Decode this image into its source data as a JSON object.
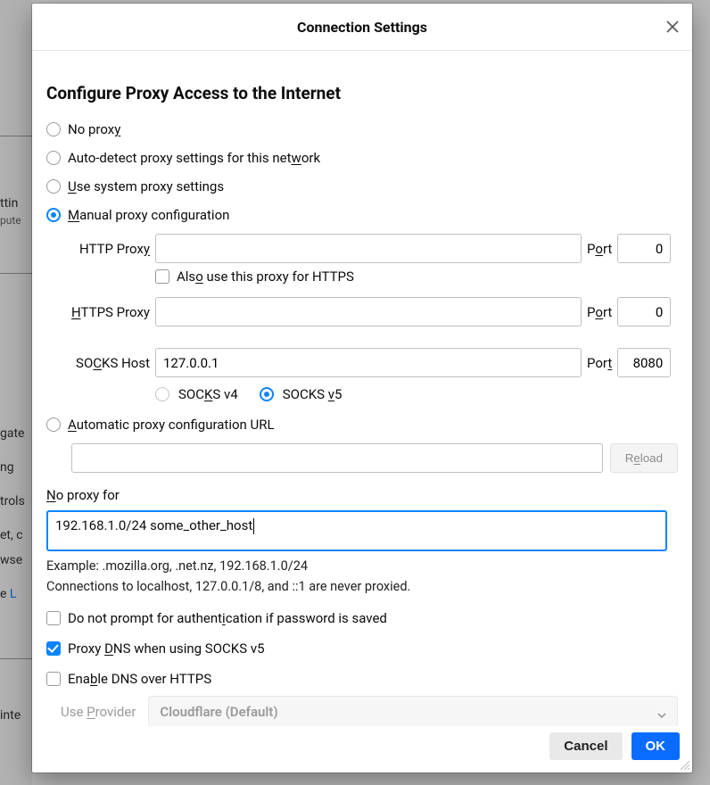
{
  "bg": {
    "rows": [
      "ttin",
      "pute",
      "gate",
      "ng",
      "trols",
      "et, c",
      "wse",
      "e  ",
      "inte"
    ],
    "link": "L"
  },
  "modal": {
    "title": "Connection Settings",
    "section": "Configure Proxy Access to the Internet",
    "options": {
      "no_proxy": "No prox",
      "no_proxy_u": "y",
      "auto_detect_a": "Auto-detect proxy settings for this net",
      "auto_detect_u": "w",
      "auto_detect_b": "ork",
      "use_system_u": "U",
      "use_system_b": "se system proxy settings",
      "manual_u": "M",
      "manual_b": "anual proxy configuration",
      "auto_url_u": "A",
      "auto_url_b": "utomatic proxy configuration URL"
    },
    "http": {
      "label_a": "HTTP Prox",
      "label_u": "y",
      "value": "",
      "port_a": "P",
      "port_u": "o",
      "port_b": "rt",
      "port": "0"
    },
    "https_also_a": "Als",
    "https_also_u": "o",
    "https_also_b": " use this proxy for HTTPS",
    "https": {
      "label_u": "H",
      "label_b": "TTPS Proxy",
      "value": "",
      "port_a": "P",
      "port_u": "o",
      "port_b": "rt",
      "port": "0"
    },
    "socks": {
      "label_a": "SO",
      "label_u": "C",
      "label_b": "KS Host",
      "value": "127.0.0.1",
      "port_a": "Por",
      "port_u": "t",
      "port": "8080"
    },
    "socks_v4_a": "SOC",
    "socks_v4_u": "K",
    "socks_v4_b": "S v4",
    "socks_v5_a": "SOCKS ",
    "socks_v5_u": "v",
    "socks_v5_b": "5",
    "reload_a": "R",
    "reload_u": "e",
    "reload_b": "load",
    "noproxy_label_u": "N",
    "noproxy_label_b": "o proxy for",
    "noproxy_value": "192.168.1.0/24 some_other_host",
    "example": "Example: .mozilla.org, .net.nz, 192.168.1.0/24",
    "never": "Connections to localhost, 127.0.0.1/8, and ::1 are never proxied.",
    "chk_auth_a": "Do not prompt for authent",
    "chk_auth_u": "i",
    "chk_auth_b": "cation if password is saved",
    "chk_dns_a": "Proxy ",
    "chk_dns_u": "D",
    "chk_dns_b": "NS when using SOCKS v5",
    "chk_doh_a": "Ena",
    "chk_doh_u": "b",
    "chk_doh_b": "le DNS over HTTPS",
    "provider_label_a": "Use ",
    "provider_label_u": "P",
    "provider_label_b": "rovider",
    "provider_value": "Cloudflare (Default)",
    "cancel": "Cancel",
    "ok": "OK"
  }
}
